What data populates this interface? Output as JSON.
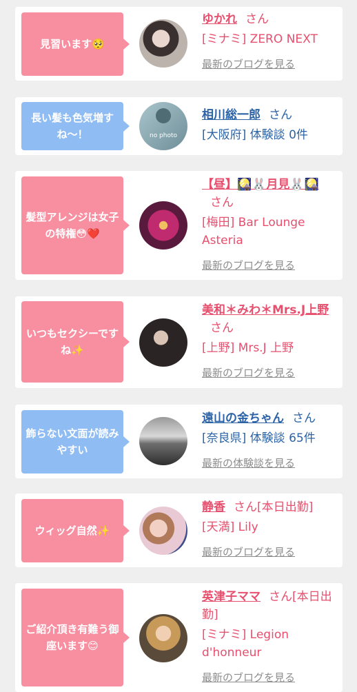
{
  "reviews": [
    {
      "comment": "見習います🥺",
      "name": "ゆかれ",
      "honorific": "さん",
      "location": "[ミナミ] ZERO NEXT",
      "link": "最新のブログを見る"
    },
    {
      "comment": "長い髪も色気増すね〜！",
      "name": "相川総一郎",
      "honorific": "さん",
      "location": "[大阪府] 体験談 0件",
      "link": "",
      "avatar_text": "no photo"
    },
    {
      "comment": "髪型アレンジは女子の特権😳❤️",
      "name": "【昼】🎑🐰月見🐰🎑",
      "honorific": "さん",
      "location": "[梅田] Bar Lounge Asteria",
      "link": "最新のブログを見る"
    },
    {
      "comment": "いつもセクシーですね✨",
      "name": "美和＊みわ＊Mrs.J上野",
      "honorific": "さん",
      "location": "[上野] Mrs.J 上野",
      "link": "最新のブログを見る"
    },
    {
      "comment": "飾らない文面が読みやすい",
      "name": "遠山の金ちゃん",
      "honorific": "さん",
      "location": "[奈良県] 体験談 65件",
      "link": "最新の体験談を見る"
    },
    {
      "comment": "ウィッグ自然✨",
      "name": "静香",
      "honorific": "さん[本日出勤]",
      "location": "[天満] Lily",
      "link": "最新のブログを見る"
    },
    {
      "comment": "ご紹介頂き有難う御座います😊",
      "name": "英津子ママ",
      "honorific": "さん[本日出勤]",
      "location": "[ミナミ] Legion d'honneur",
      "link": "最新のブログを見る"
    }
  ],
  "colors": {
    "pink": "#f78fa1",
    "blue": "#8fbcf3",
    "name_pink": "#e64f6e",
    "name_blue": "#2b63a6",
    "link_gray": "#8c8c8c"
  }
}
